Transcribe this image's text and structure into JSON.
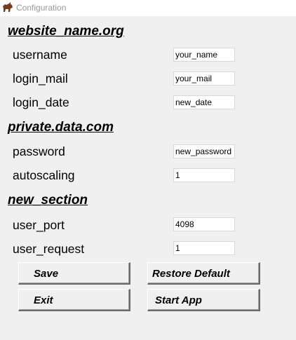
{
  "window": {
    "title": "Configuration",
    "icon": "horse-app-icon"
  },
  "sections": [
    {
      "title": "website_name.org",
      "fields": [
        {
          "label": "username",
          "value": "your_name"
        },
        {
          "label": "login_mail",
          "value": "your_mail"
        },
        {
          "label": "login_date",
          "value": "new_date"
        }
      ]
    },
    {
      "title": "private.data.com",
      "fields": [
        {
          "label": "password",
          "value": "new_password"
        },
        {
          "label": "autoscaling",
          "value": "1"
        }
      ]
    },
    {
      "title": "new_section",
      "fields": [
        {
          "label": "user_port",
          "value": "4098"
        },
        {
          "label": "user_request",
          "value": "1"
        }
      ]
    }
  ],
  "buttons": {
    "save": "Save",
    "restore_default": "Restore Default",
    "exit": "Exit",
    "start_app": "Start App"
  }
}
